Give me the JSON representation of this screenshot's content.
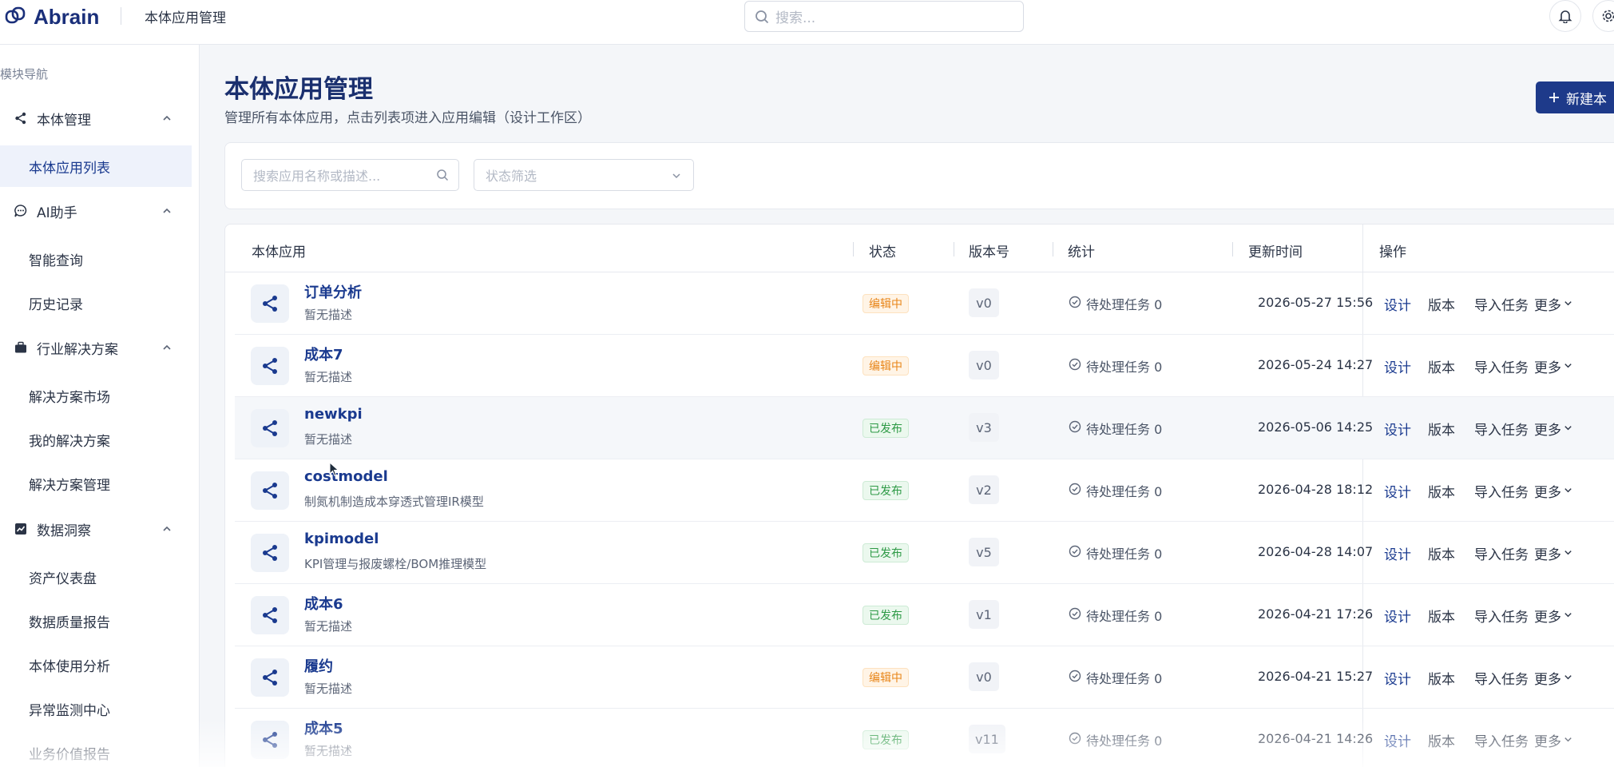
{
  "app": {
    "name": "Abrain",
    "header_title": "本体应用管理"
  },
  "top_search": {
    "placeholder": "搜索..."
  },
  "sidebar": {
    "caption": "模块导航",
    "groups": [
      {
        "label": "本体管理",
        "icon": "share-icon",
        "items": [
          "本体应用列表"
        ]
      },
      {
        "label": "AI助手",
        "icon": "chat-icon",
        "items": [
          "智能查询",
          "历史记录"
        ]
      },
      {
        "label": "行业解决方案",
        "icon": "briefcase-icon",
        "items": [
          "解决方案市场",
          "我的解决方案",
          "解决方案管理"
        ]
      },
      {
        "label": "数据洞察",
        "icon": "chart-icon",
        "items": [
          "资产仪表盘",
          "数据质量报告",
          "本体使用分析",
          "异常监测中心",
          "业务价值报告"
        ]
      }
    ]
  },
  "main": {
    "title": "本体应用管理",
    "subtitle": "管理所有本体应用，点击列表项进入应用编辑（设计工作区）",
    "new_button": "新建本",
    "filter": {
      "search_placeholder": "搜索应用名称或描述...",
      "status_placeholder": "状态筛选"
    }
  },
  "table": {
    "columns": [
      "本体应用",
      "状态",
      "版本号",
      "统计",
      "更新时间",
      "操作"
    ],
    "actions": {
      "design": "设计",
      "version": "版本",
      "import": "导入任务",
      "more": "更多"
    },
    "rows": [
      {
        "name": "订单分析",
        "desc": "暂无描述",
        "status": "编辑中",
        "status_type": "edit",
        "version": "v0",
        "stat": "待处理任务 0",
        "updated": "2026-05-27 15:56"
      },
      {
        "name": "成本7",
        "desc": "暂无描述",
        "status": "编辑中",
        "status_type": "edit",
        "version": "v0",
        "stat": "待处理任务 0",
        "updated": "2026-05-24 14:27"
      },
      {
        "name": "newkpi",
        "desc": "暂无描述",
        "status": "已发布",
        "status_type": "pub",
        "version": "v3",
        "stat": "待处理任务 0",
        "updated": "2026-05-06 14:25"
      },
      {
        "name": "costmodel",
        "desc": "制氮机制造成本穿透式管理IR模型",
        "status": "已发布",
        "status_type": "pub",
        "version": "v2",
        "stat": "待处理任务 0",
        "updated": "2026-04-28 18:12"
      },
      {
        "name": "kpimodel",
        "desc": "KPI管理与报废螺栓/BOM推理模型",
        "status": "已发布",
        "status_type": "pub",
        "version": "v5",
        "stat": "待处理任务 0",
        "updated": "2026-04-28 14:07"
      },
      {
        "name": "成本6",
        "desc": "暂无描述",
        "status": "已发布",
        "status_type": "pub",
        "version": "v1",
        "stat": "待处理任务 0",
        "updated": "2026-04-21 17:26"
      },
      {
        "name": "履约",
        "desc": "暂无描述",
        "status": "编辑中",
        "status_type": "edit",
        "version": "v0",
        "stat": "待处理任务 0",
        "updated": "2026-04-21 15:27"
      },
      {
        "name": "成本5",
        "desc": "暂无描述",
        "status": "已发布",
        "status_type": "pub",
        "version": "v11",
        "stat": "待处理任务 0",
        "updated": "2026-04-21 14:26"
      }
    ]
  },
  "colors": {
    "primary": "#1e3a8a",
    "edit_badge": "#e8861a",
    "published_badge": "#2e9a46"
  }
}
